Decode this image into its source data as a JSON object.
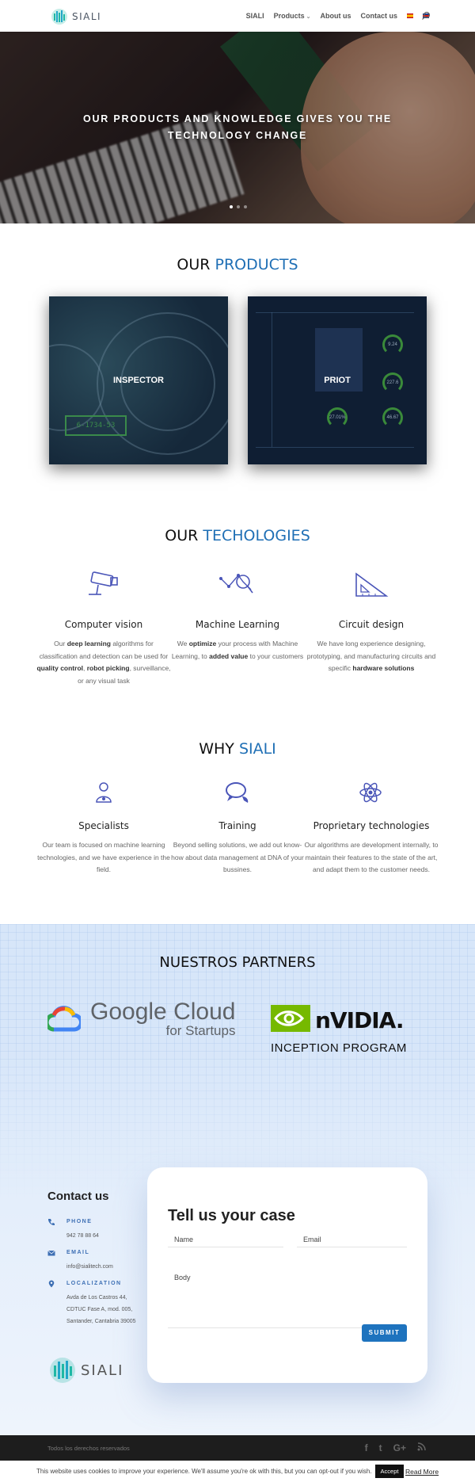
{
  "header": {
    "logo_text": "SIALI",
    "nav": [
      "SIALI",
      "Products",
      "About us",
      "Contact us"
    ]
  },
  "hero": {
    "title": "OUR PRODUCTS AND KNOWLEDGE GIVES YOU THE TECHNOLOGY CHANGE"
  },
  "products": {
    "title_a": "OUR",
    "title_b": "PRODUCTS",
    "cards": [
      {
        "label": "INSPECTOR",
        "screen_text": "6-1734-53"
      },
      {
        "label": "PRIOT",
        "gauges": [
          "9.24",
          "227.6",
          "27.01%",
          "46.67"
        ]
      }
    ]
  },
  "technologies": {
    "title_a": "OUR",
    "title_b": "TECHOLOGIES",
    "items": [
      {
        "icon": "cctv-camera-icon",
        "title": "Computer vision",
        "parts": [
          "Our ",
          "deep learning",
          " algorithms for classification and detection can be used for ",
          "quality control",
          ", ",
          "robot picking",
          ", surveillance, or any visual task"
        ]
      },
      {
        "icon": "ml-network-icon",
        "title": "Machine Learning",
        "parts": [
          "We ",
          "optimize",
          " your process with Machine Learning, to ",
          "added value",
          " to your customers"
        ]
      },
      {
        "icon": "set-square-icon",
        "title": "Circuit design",
        "parts": [
          "We have long experience designing, prototyping, and manufacturing circuits and specific ",
          "hardware solutions",
          ""
        ]
      }
    ]
  },
  "why": {
    "title_a": "WHY",
    "title_b": "SIALI",
    "items": [
      {
        "icon": "specialist-icon",
        "title": "Specialists",
        "text": "Our team is focused on machine learning technologies, and we have experience in the field."
      },
      {
        "icon": "chat-bubbles-icon",
        "title": "Training",
        "text": "Beyond selling solutions, we add out know-how about data management at DNA of your bussines."
      },
      {
        "icon": "atom-icon",
        "title": "Proprietary technologies",
        "text": "Our algorithms are development internally, to maintain their features to the state of the art, and adapt them to the customer needs."
      }
    ]
  },
  "partners": {
    "title": "NUESTROS PARTNERS",
    "google_line1": "Google Cloud",
    "google_line2": "for Startups",
    "nvidia_word": "nVIDIA.",
    "nvidia_sub": "INCEPTION PROGRAM"
  },
  "contact": {
    "title": "Contact us",
    "phone_label": "PHONE",
    "phone": "942 78 88 64",
    "email_label": "EMAIL",
    "email": "info@sialitech.com",
    "loc_label": "LOCALIZATION",
    "address": "Avda de Los Castros 44, CDTUC Fase A, mod. 005, Santander, Cantabria 39005",
    "form_title": "Tell us your case",
    "name_placeholder": "Name",
    "email_placeholder": "Email",
    "body_placeholder": "Body",
    "submit": "SUBMIT"
  },
  "footer": {
    "copyright": "Todos los derechos reservados",
    "social": [
      "f",
      "t",
      "G+",
      "rss"
    ]
  },
  "cookie": {
    "message": "This website uses cookies to improve your experience. We'll assume you're ok with this, but you can opt-out if you wish.",
    "accept": "Accept",
    "read_more": "Read More"
  },
  "colors": {
    "accent": "#1f6fb5",
    "icon": "#4a55b8",
    "teal": "#1fb8a5"
  }
}
